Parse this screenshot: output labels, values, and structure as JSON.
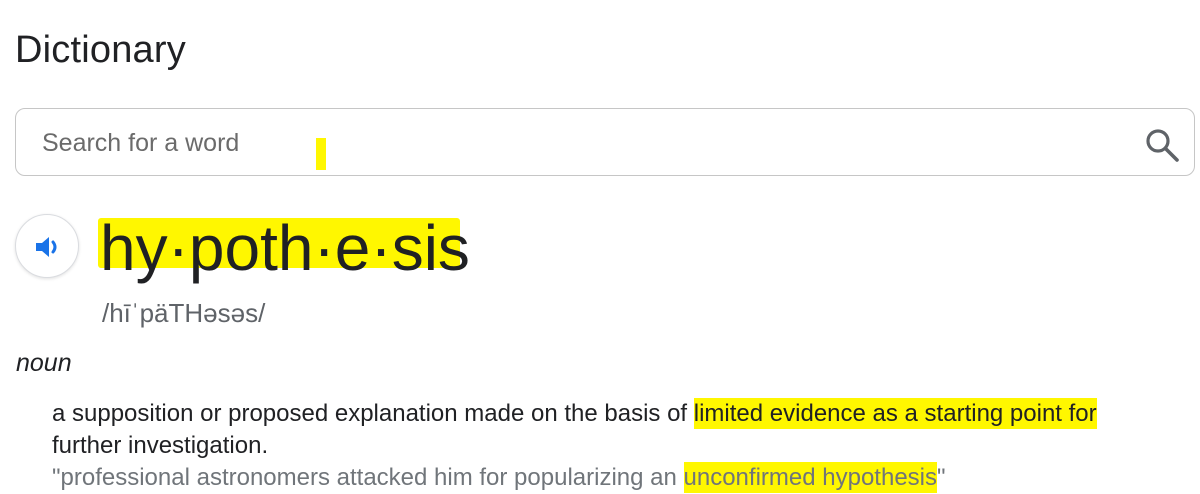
{
  "app": {
    "title": "Dictionary"
  },
  "search": {
    "placeholder": "Search for a word",
    "value": "",
    "icon": "search-icon"
  },
  "entry": {
    "speaker_icon": "volume-icon",
    "headword": "hy·poth·e·sis",
    "phonetic": "/hīˈpäTHəsəs/",
    "part_of_speech": "noun",
    "definition": {
      "plain": "a supposition or proposed explanation made on the basis of ",
      "highlighted_1": "limited evidence as a starting point for",
      "continuation": "further investigation."
    },
    "example": {
      "plain": "\"professional astronomers attacked him for popularizing an ",
      "highlighted": "unconfirmed hypothesis",
      "end": "\""
    }
  },
  "colors": {
    "highlight": "#fff700",
    "speaker_blue": "#1a73e8",
    "text": "#202124",
    "muted": "#70757a"
  }
}
